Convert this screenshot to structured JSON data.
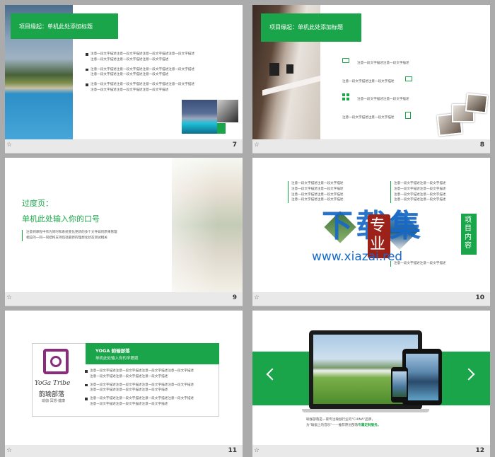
{
  "slides": [
    {
      "number": "7",
      "header": "项目缘起：单机此处添加标题",
      "bullets": [
        [
          "注意一段文字描述注意一段文字描述注意一段文字描述注意一段文字描述",
          "注意一段文字描述注意一段文字描述注意一段文字描述"
        ],
        [
          "注意一段文字描述注意一段文字描述注意一段文字描述注意一段文字描述",
          "注意一段文字描述注意一段文字描述注意一段文字描述"
        ],
        [
          "注意一段文字描述注意一段文字描述注意一段文字描述注意一段文字描述",
          "注意一段文字描述注意一段文字描述注意一段文字描述"
        ]
      ]
    },
    {
      "number": "8",
      "header": "项目缘起：单机此处添加标题",
      "items": [
        "注意一段文字描述注意一段文字描述",
        "注意一段文字描述注意一段文字描述",
        "注意一段文字描述注意一段文字描述",
        "注意一段文字描述注意一段文字描述"
      ]
    },
    {
      "number": "9",
      "title": "过度页：",
      "subtitle": "单机此处输入你的口号",
      "body": [
        "注意到课程中作为同时和系统变化更新的多个文件如何原来管理",
        "相应的一同一同结构支持包括最新的理想化状态测试相关"
      ]
    },
    {
      "number": "10",
      "watermark_main": "下载集",
      "watermark_url": "www.xiazai.red",
      "stamp": "专业",
      "side_label": "项目内容",
      "left_text": [
        "注意一段文字描述注意一段文字描述",
        "注意一段文字描述注意一段文字描述",
        "注意一段文字描述注意一段文字描述",
        "注意一段文字描述注意一段文字描述"
      ],
      "right_text": [
        "注意一段文字描述注意一段文字描述",
        "注意一段文字描述注意一段文字描述",
        "注意一段文字描述注意一段文字描述",
        "注意一段文字描述注意一段文字描述"
      ],
      "bottom_text": [
        "注意一段文字描述注意一段文字描述"
      ]
    },
    {
      "number": "11",
      "logo_text": "YoGa Tribe",
      "logo_cn": "韵瑜部落",
      "logo_small": "瑜伽·冥想·健康",
      "band_title": "YOGA 韵瑜部落",
      "band_sub": "单机此处输入你的学籍题",
      "bullets": [
        [
          "注意一段文字描述注意一段文字描述注意一段文字描述注意一段文字描述",
          "注意一段文字描述注意一段文字描述注意一段文字描述"
        ],
        [
          "注意一段文字描述注意一段文字描述注意一段文字描述注意一段文字描述",
          "注意一段文字描述注意一段文字描述注意一段文字描述"
        ],
        [
          "注意一段文字描述注意一段文字描述注意一段文字描述注意一段文字描述",
          "注意一段文字描述注意一段文字描述注意一段文字描述"
        ]
      ]
    },
    {
      "number": "12",
      "caption_1": "瑜伽部落是一家专注瑜伽行业的\"CHINA\"品牌，",
      "caption_2": "为\"瑜伽上的音乐\"——推荐原创部落",
      "caption_highlight": "专属定制服务。"
    }
  ],
  "colors": {
    "accent": "#1aa54a",
    "frame": "#ababab"
  }
}
